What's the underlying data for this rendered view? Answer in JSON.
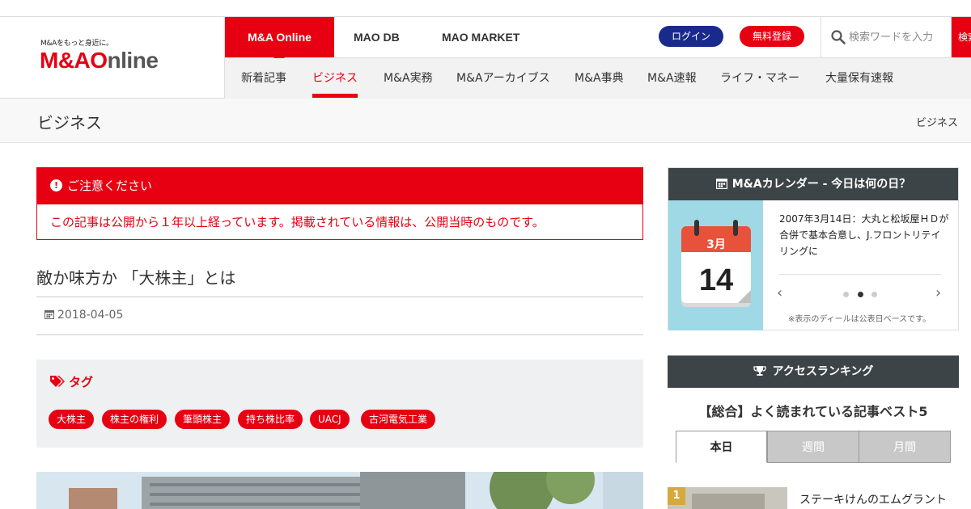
{
  "header": {
    "logo_tagline": "M&Aをもっと身近に。",
    "logo_text_red_1": "M&A",
    "logo_text_red_2": "O",
    "logo_text_gray": "nline",
    "nav_tabs": [
      {
        "label": "M&A Online",
        "active": true
      },
      {
        "label": "MAO DB",
        "active": false
      },
      {
        "label": "MAO MARKET",
        "active": false
      }
    ],
    "login_label": "ログイン",
    "register_label": "無料登録",
    "search_placeholder": "検索ワードを入力",
    "search_button": "検索",
    "sub_nav": [
      {
        "label": "新着記事",
        "active": false
      },
      {
        "label": "ビジネス",
        "active": true
      },
      {
        "label": "M&A実務",
        "active": false
      },
      {
        "label": "M&Aアーカイブス",
        "active": false
      },
      {
        "label": "M&A事典",
        "active": false
      },
      {
        "label": "M&A速報",
        "active": false
      },
      {
        "label": "ライフ・マネー",
        "active": false
      },
      {
        "label": "大量保有速報",
        "active": false
      }
    ]
  },
  "page": {
    "title": "ビジネス",
    "breadcrumb": "ビジネス"
  },
  "notice": {
    "icon": "exclamation-circle-icon",
    "heading": "ご注意ください",
    "body": "この記事は公開から１年以上経っています。掲載されている情報は、公開当時のものです。"
  },
  "article": {
    "title": "敵か味方か 「大株主」とは",
    "date": "2018-04-05",
    "tags_heading": "タグ",
    "tags": [
      "大株主",
      "株主の権利",
      "筆頭株主",
      "持ち株比率",
      "UACJ",
      "古河電気工業"
    ]
  },
  "calendar": {
    "heading": "M&Aカレンダー - 今日は何の日？",
    "month": "3月",
    "day": "14",
    "entry": "2007年3月14日：大丸と松坂屋ＨＤが合併で基本合意し、J.フロントリテイリングに",
    "note": "※表示のディールは公表日ベースです。",
    "active_dot": 2
  },
  "ranking": {
    "heading": "アクセスランキング",
    "title": "【総合】よく読まれている記事ベスト5",
    "tabs": [
      {
        "label": "本日",
        "active": true
      },
      {
        "label": "週間",
        "active": false
      },
      {
        "label": "月間",
        "active": false
      }
    ],
    "first_rank": "1",
    "first_title": "ステーキけんのエムグラント"
  },
  "colors": {
    "brand_red": "#e60012",
    "dark_header": "#3d4448",
    "login_blue": "#1a2a8c"
  }
}
